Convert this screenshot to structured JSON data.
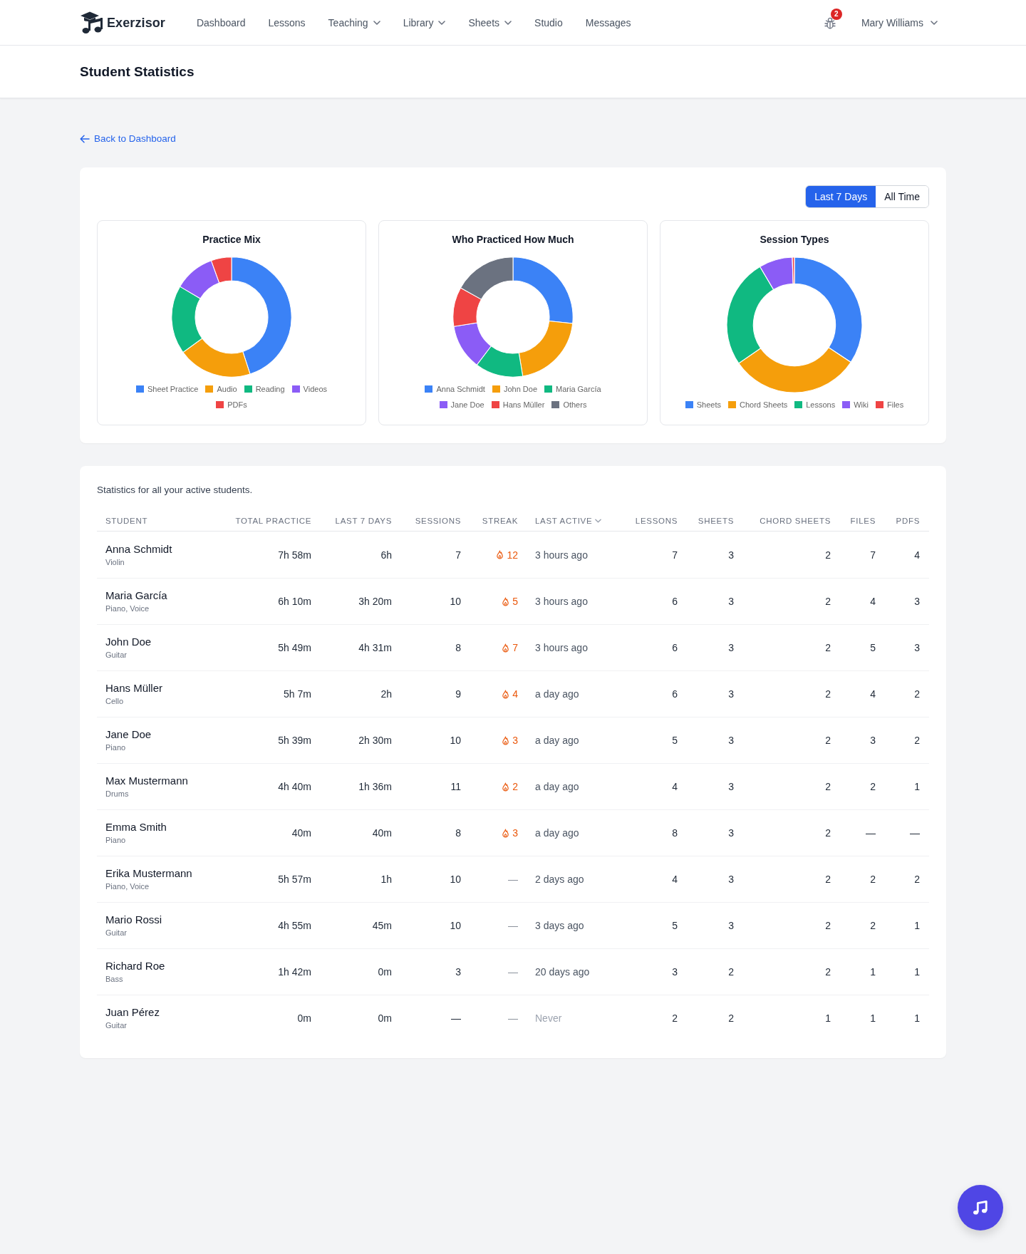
{
  "nav": {
    "brand": "Exerzisor",
    "links": [
      {
        "label": "Dashboard",
        "dropdown": false
      },
      {
        "label": "Lessons",
        "dropdown": false
      },
      {
        "label": "Teaching",
        "dropdown": true
      },
      {
        "label": "Library",
        "dropdown": true
      },
      {
        "label": "Sheets",
        "dropdown": true
      },
      {
        "label": "Studio",
        "dropdown": false
      },
      {
        "label": "Messages",
        "dropdown": false
      }
    ],
    "notification_count": "2",
    "user": {
      "name": "Mary Williams",
      "dropdown": true
    }
  },
  "page_header": {
    "title": "Student Statistics"
  },
  "back_link": {
    "label": "Back to Dashboard"
  },
  "charts_panel": {
    "range_toggle": [
      {
        "label": "Last 7 Days",
        "selected": true
      },
      {
        "label": "All Time",
        "selected": false
      }
    ],
    "charts": [
      {
        "title": "Practice Mix",
        "legend": [
          {
            "label": "Sheet Practice",
            "color": "#3b82f6"
          },
          {
            "label": "Audio",
            "color": "#f59e0b"
          },
          {
            "label": "Reading",
            "color": "#10b981"
          },
          {
            "label": "Videos",
            "color": "#8b5cf6"
          },
          {
            "label": "PDFs",
            "color": "#ef4444"
          }
        ]
      },
      {
        "title": "Who Practiced How Much",
        "legend": [
          {
            "label": "Anna Schmidt",
            "color": "#3b82f6"
          },
          {
            "label": "John Doe",
            "color": "#f59e0b"
          },
          {
            "label": "Maria García",
            "color": "#10b981"
          },
          {
            "label": "Jane Doe",
            "color": "#8b5cf6"
          },
          {
            "label": "Hans Müller",
            "color": "#ef4444"
          },
          {
            "label": "Others",
            "color": "#6b7280"
          }
        ]
      },
      {
        "title": "Session Types",
        "legend": [
          {
            "label": "Sheets",
            "color": "#3b82f6"
          },
          {
            "label": "Chord Sheets",
            "color": "#f59e0b"
          },
          {
            "label": "Lessons",
            "color": "#10b981"
          },
          {
            "label": "Wiki",
            "color": "#8b5cf6"
          },
          {
            "label": "Files",
            "color": "#ef4444"
          }
        ]
      }
    ]
  },
  "stats_panel": {
    "caption": "Statistics for all your active students.",
    "columns": [
      {
        "label": "STUDENT",
        "sorted": false
      },
      {
        "label": "TOTAL PRACTICE",
        "sorted": false
      },
      {
        "label": "LAST 7 DAYS",
        "sorted": false
      },
      {
        "label": "SESSIONS",
        "sorted": false
      },
      {
        "label": "STREAK",
        "sorted": false
      },
      {
        "label": "LAST ACTIVE",
        "sorted": true
      },
      {
        "label": "LESSONS",
        "sorted": false
      },
      {
        "label": "SHEETS",
        "sorted": false
      },
      {
        "label": "CHORD SHEETS",
        "sorted": false
      },
      {
        "label": "FILES",
        "sorted": false
      },
      {
        "label": "PDFS",
        "sorted": false
      }
    ],
    "rows": [
      {
        "name": "Anna Schmidt",
        "instruments": "Violin",
        "total_practice": "7h 58m",
        "last_7_days": "6h",
        "sessions": "7",
        "streak": {
          "value": "12",
          "active": true
        },
        "last_active": {
          "text": "3 hours ago",
          "muted": false
        },
        "lessons": "7",
        "sheets": "3",
        "chord_sheets": "2",
        "files": "7",
        "pdfs": "4"
      },
      {
        "name": "Maria García",
        "instruments": "Piano, Voice",
        "total_practice": "6h 10m",
        "last_7_days": "3h 20m",
        "sessions": "10",
        "streak": {
          "value": "5",
          "active": true
        },
        "last_active": {
          "text": "3 hours ago",
          "muted": false
        },
        "lessons": "6",
        "sheets": "3",
        "chord_sheets": "2",
        "files": "4",
        "pdfs": "3"
      },
      {
        "name": "John Doe",
        "instruments": "Guitar",
        "total_practice": "5h 49m",
        "last_7_days": "4h 31m",
        "sessions": "8",
        "streak": {
          "value": "7",
          "active": true
        },
        "last_active": {
          "text": "3 hours ago",
          "muted": false
        },
        "lessons": "6",
        "sheets": "3",
        "chord_sheets": "2",
        "files": "5",
        "pdfs": "3"
      },
      {
        "name": "Hans Müller",
        "instruments": "Cello",
        "total_practice": "5h 7m",
        "last_7_days": "2h",
        "sessions": "9",
        "streak": {
          "value": "4",
          "active": true
        },
        "last_active": {
          "text": "a day ago",
          "muted": false
        },
        "lessons": "6",
        "sheets": "3",
        "chord_sheets": "2",
        "files": "4",
        "pdfs": "2"
      },
      {
        "name": "Jane Doe",
        "instruments": "Piano",
        "total_practice": "5h 39m",
        "last_7_days": "2h 30m",
        "sessions": "10",
        "streak": {
          "value": "3",
          "active": true
        },
        "last_active": {
          "text": "a day ago",
          "muted": false
        },
        "lessons": "5",
        "sheets": "3",
        "chord_sheets": "2",
        "files": "3",
        "pdfs": "2"
      },
      {
        "name": "Max Mustermann",
        "instruments": "Drums",
        "total_practice": "4h 40m",
        "last_7_days": "1h 36m",
        "sessions": "11",
        "streak": {
          "value": "2",
          "active": true
        },
        "last_active": {
          "text": "a day ago",
          "muted": false
        },
        "lessons": "4",
        "sheets": "3",
        "chord_sheets": "2",
        "files": "2",
        "pdfs": "1"
      },
      {
        "name": "Emma Smith",
        "instruments": "Piano",
        "total_practice": "40m",
        "last_7_days": "40m",
        "sessions": "8",
        "streak": {
          "value": "3",
          "active": true
        },
        "last_active": {
          "text": "a day ago",
          "muted": false
        },
        "lessons": "8",
        "sheets": "3",
        "chord_sheets": "2",
        "files": "—",
        "pdfs": "—"
      },
      {
        "name": "Erika Mustermann",
        "instruments": "Piano, Voice",
        "total_practice": "5h 57m",
        "last_7_days": "1h",
        "sessions": "10",
        "streak": {
          "value": "—",
          "active": false
        },
        "last_active": {
          "text": "2 days ago",
          "muted": false
        },
        "lessons": "4",
        "sheets": "3",
        "chord_sheets": "2",
        "files": "2",
        "pdfs": "2"
      },
      {
        "name": "Mario Rossi",
        "instruments": "Guitar",
        "total_practice": "4h 55m",
        "last_7_days": "45m",
        "sessions": "10",
        "streak": {
          "value": "—",
          "active": false
        },
        "last_active": {
          "text": "3 days ago",
          "muted": false
        },
        "lessons": "5",
        "sheets": "3",
        "chord_sheets": "2",
        "files": "2",
        "pdfs": "1"
      },
      {
        "name": "Richard Roe",
        "instruments": "Bass",
        "total_practice": "1h 42m",
        "last_7_days": "0m",
        "sessions": "3",
        "streak": {
          "value": "—",
          "active": false
        },
        "last_active": {
          "text": "20 days ago",
          "muted": false
        },
        "lessons": "3",
        "sheets": "2",
        "chord_sheets": "2",
        "files": "1",
        "pdfs": "1"
      },
      {
        "name": "Juan Pérez",
        "instruments": "Guitar",
        "total_practice": "0m",
        "last_7_days": "0m",
        "sessions": "—",
        "streak": {
          "value": "—",
          "active": false
        },
        "last_active": {
          "text": "Never",
          "muted": true
        },
        "lessons": "2",
        "sheets": "2",
        "chord_sheets": "1",
        "files": "1",
        "pdfs": "1"
      }
    ]
  }
}
